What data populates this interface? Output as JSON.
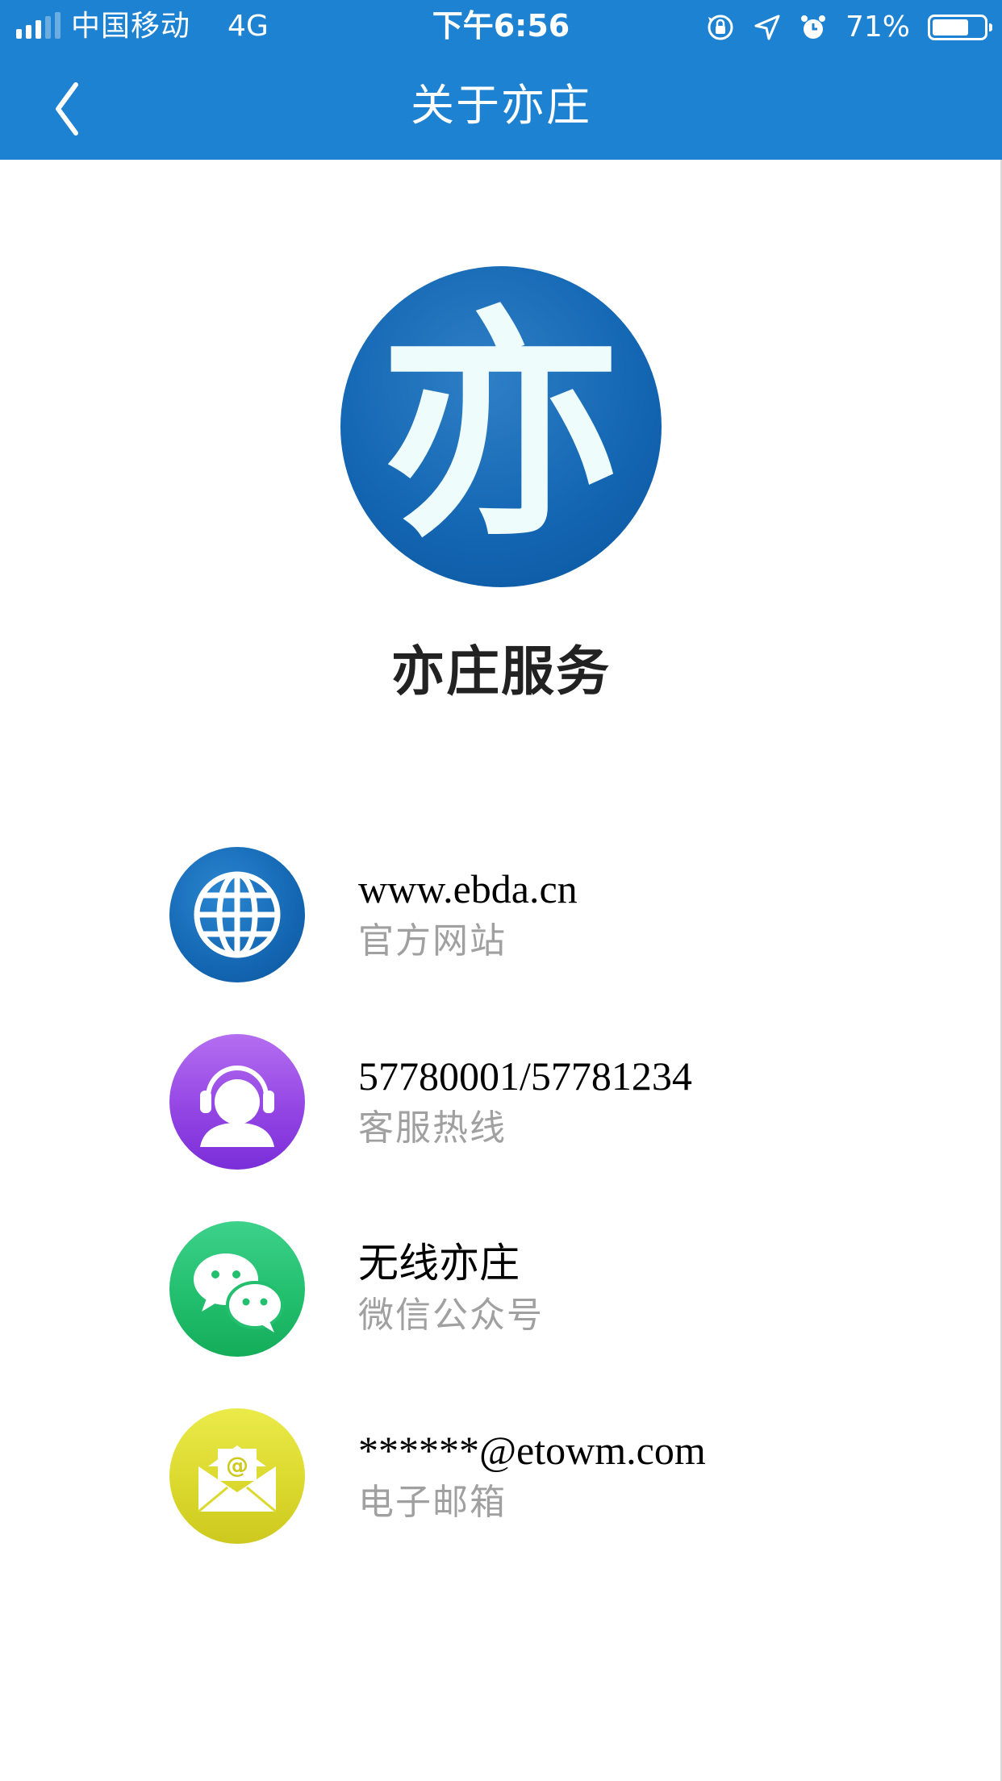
{
  "status_bar": {
    "carrier": "中国移动",
    "network": "4G",
    "time": "下午6:56",
    "battery_percent": "71%",
    "battery_level": 0.71,
    "icons": [
      "signal-icon",
      "orientation-lock-icon",
      "location-arrow-icon",
      "alarm-icon",
      "battery-icon"
    ]
  },
  "nav": {
    "title": "关于亦庄",
    "back_icon": "chevron-left-icon"
  },
  "app": {
    "logo_glyph": "亦",
    "name": "亦庄服务"
  },
  "contacts": [
    {
      "icon": "globe-icon",
      "value": "www.ebda.cn",
      "label": "官方网站"
    },
    {
      "icon": "headset-user-icon",
      "value": "57780001/57781234",
      "label": "客服热线"
    },
    {
      "icon": "wechat-icon",
      "value": "无线亦庄",
      "label": "微信公众号"
    },
    {
      "icon": "envelope-at-icon",
      "value": "******@etowm.com",
      "label": "电子邮箱"
    }
  ],
  "colors": {
    "header": "#1e82d2",
    "logo": "#1467b3",
    "globe": "#1a72c0",
    "headset": "#9446e4",
    "wechat": "#22bf6e",
    "mail": "#dcd92e"
  }
}
